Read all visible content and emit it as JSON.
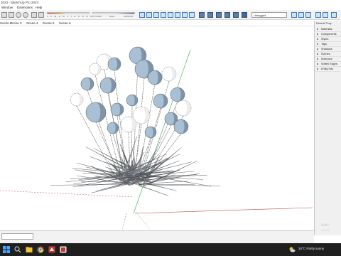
{
  "window": {
    "title": "2023 - SketchUp Pro 2023"
  },
  "menu": {
    "items": [
      "Window",
      "Extensions",
      "Help"
    ]
  },
  "toolbar": {
    "shadow_months": "J F M A M J J A S O N D",
    "time_start": "07:15 AM",
    "time_noon": "Noon",
    "time_end": "04:00 PM",
    "tag_select": "Untagged"
  },
  "scenes": {
    "tabs": [
      "Scene 2",
      "Scene 3",
      "Scene 4",
      "Scene 5",
      "Scene 6"
    ]
  },
  "tray": {
    "title": "Default Tray",
    "items": [
      "Materials",
      "Components",
      "Styles",
      "Tags",
      "Shadows",
      "Scenes",
      "Instructor",
      "Soften Edges",
      "Entity Info"
    ],
    "watermark_line1": "Activ",
    "watermark_line2": "Go to Se"
  },
  "taskbar": {
    "weather_temp": "34°C",
    "weather_text": "Partly sunny"
  },
  "colors": {
    "blue_axis": "#3a6fb8",
    "green_axis": "#2aa84a",
    "red_axis": "#c84b4b",
    "balloon_fill": "#a9c0d4"
  },
  "icons": [
    "select-icon",
    "eraser-icon",
    "undo-icon",
    "redo-icon",
    "orbit-icon",
    "zoom-icon",
    "view-cube-icon",
    "scenes-icon"
  ]
}
